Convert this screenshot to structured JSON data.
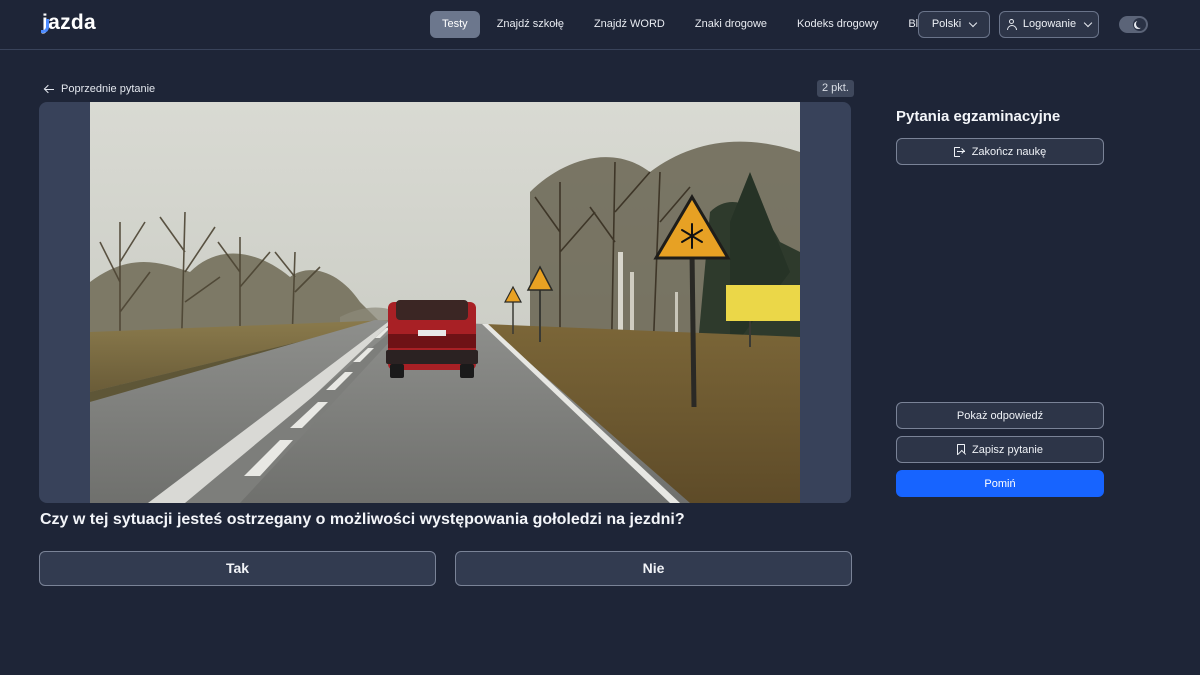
{
  "brand": {
    "logo_text": "jazda",
    "accent": "#4d8bff"
  },
  "nav": {
    "items": [
      {
        "label": "Testy",
        "active": true
      },
      {
        "label": "Znajdź szkołę",
        "active": false
      },
      {
        "label": "Znajdź WORD",
        "active": false
      },
      {
        "label": "Znaki drogowe",
        "active": false
      },
      {
        "label": "Kodeks drogowy",
        "active": false
      },
      {
        "label": "Blog",
        "active": false
      }
    ],
    "language_label": "Polski",
    "login_label": "Logowanie",
    "theme_toggle_icon": "moon-icon"
  },
  "question": {
    "back_label": "Poprzednie pytanie",
    "points_label": "2 pkt.",
    "text": "Czy w tej sytuacji jesteś ostrzegany o możliwości występowania gołoledzi na jezdni?",
    "answers": [
      "Tak",
      "Nie"
    ]
  },
  "sidebar": {
    "title": "Pytania egzaminacyjne",
    "finish_label": "Zakończ naukę",
    "show_answer_label": "Pokaż odpowiedź",
    "save_label": "Zapisz pytanie",
    "skip_label": "Pomiń",
    "skip_color": "#1764ff"
  }
}
